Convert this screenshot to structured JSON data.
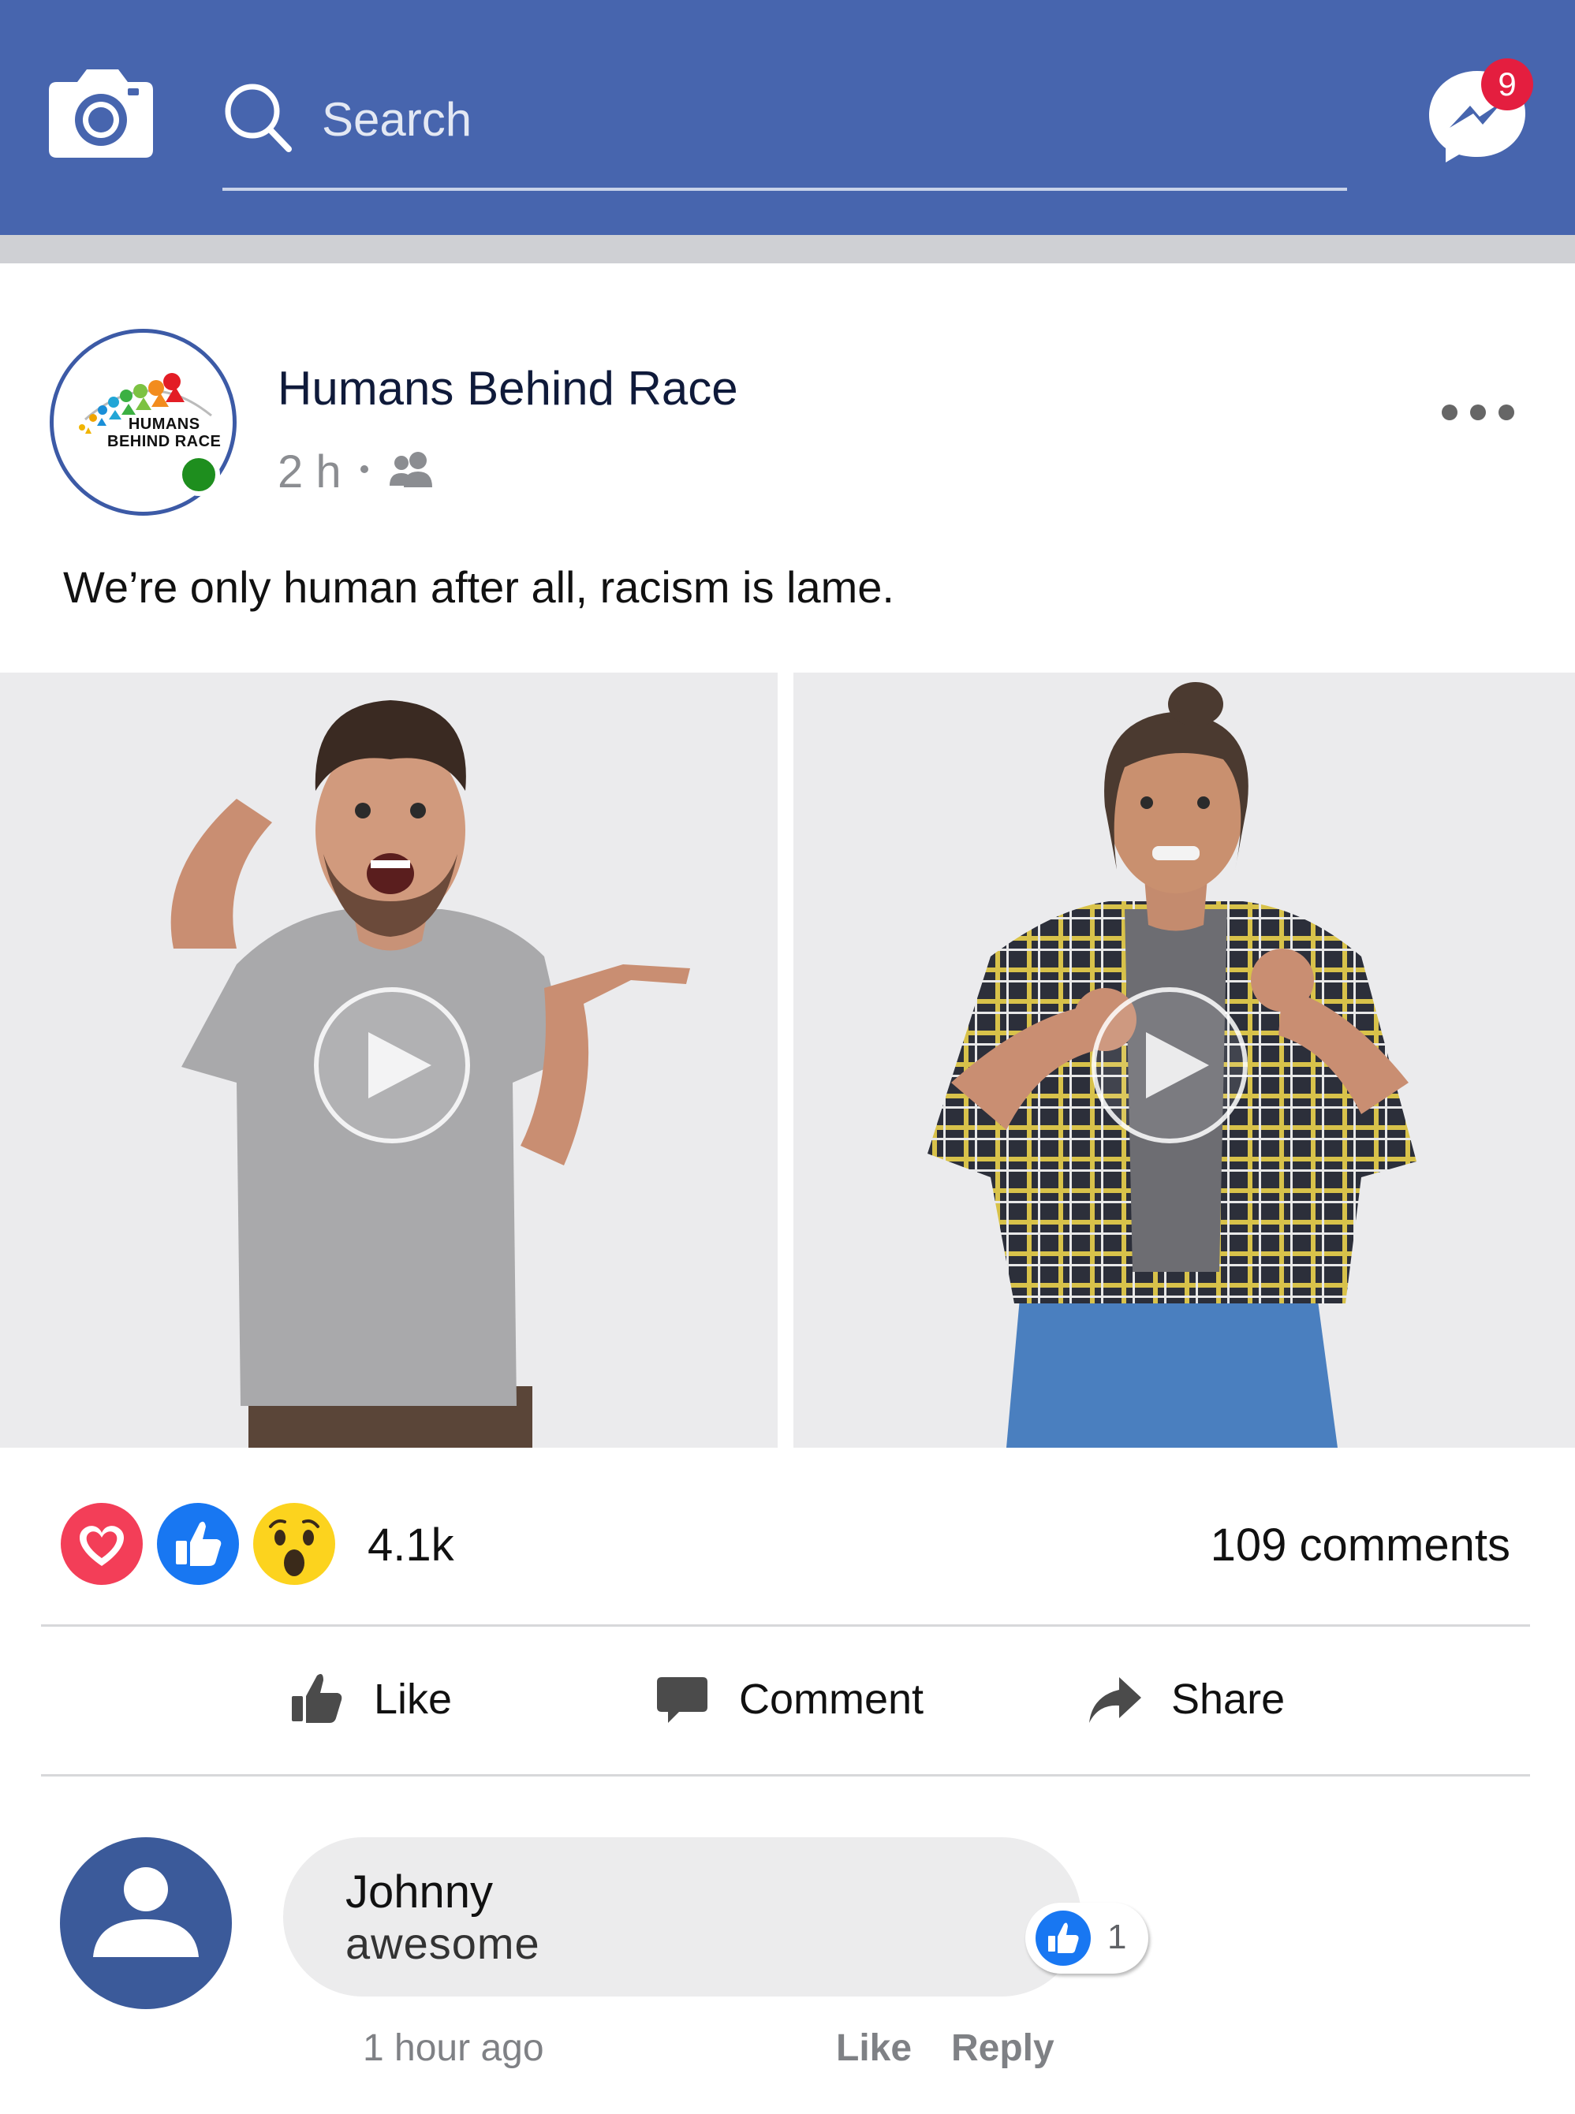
{
  "header": {
    "search_placeholder": "Search",
    "messenger_badge": "9",
    "icons": [
      "camera-icon",
      "search-icon",
      "messenger-icon"
    ]
  },
  "post": {
    "page_name": "Humans Behind Race",
    "logo_text": "HUMANS\nBEHIND RACE",
    "time": "2 h",
    "privacy_icon": "friends-icon",
    "text": "We’re only human after all, racism is lame.",
    "media": [
      {
        "type": "video",
        "description_icon": "play-icon"
      },
      {
        "type": "video",
        "description_icon": "play-icon"
      }
    ]
  },
  "stats": {
    "reactions": [
      "love",
      "like",
      "wow"
    ],
    "reaction_count": "4.1k",
    "comments_count": "109 comments"
  },
  "actions": {
    "like_label": "Like",
    "comment_label": "Comment",
    "share_label": "Share"
  },
  "comment": {
    "author": "Johnny",
    "text": "awesome",
    "like_count": "1",
    "time": "1 hour ago",
    "like_label": "Like",
    "reply_label": "Reply"
  },
  "colors": {
    "topbar": "#4765ae",
    "badge": "#e41e3f",
    "like_blue": "#1877f2",
    "love_red": "#f33e58",
    "wow_yellow": "#fcd31e",
    "online_green": "#1e8e1e"
  }
}
